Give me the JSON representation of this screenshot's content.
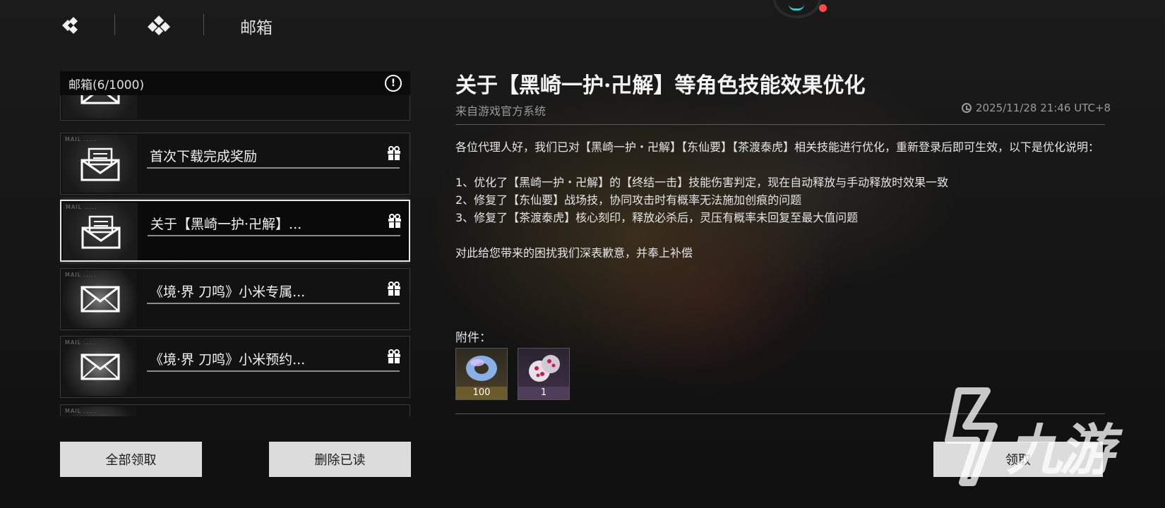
{
  "top_bar": {
    "page_title": "邮箱"
  },
  "mail_list": {
    "header": "邮箱(6/1000)",
    "items": [
      {
        "title": ""
      },
      {
        "title": "首次下载完成奖励"
      },
      {
        "title": "关于【黑崎一护·卍解】..."
      },
      {
        "title": "《境·界 刀鸣》小米专属..."
      },
      {
        "title": "《境·界 刀鸣》小米预约..."
      }
    ],
    "thumb_label": "MAIL ....."
  },
  "buttons": {
    "claim_all": "全部领取",
    "delete_read": "删除已读",
    "claim": "领取"
  },
  "detail": {
    "title": "关于【黑崎一护·卍解】等角色技能效果优化",
    "sender": "来自游戏官方系统",
    "time": "2025/11/28 21:46 UTC+8",
    "paragraphs": [
      "各位代理人好，我们已对【黑崎一护・卍解】【东仙要】【茶渡泰虎】相关技能进行优化，重新登录后即可生效，以下是优化说明：",
      "1、优化了【黑崎一护・卍解】的【终结一击】技能伤害判定，现在自动释放与手动释放时效果一致",
      "2、修复了【东仙要】战场技，协同攻击时有概率无法施加创痕的问题",
      "3、修复了【茶渡泰虎】核心刻印，释放必杀后，灵压有概率未回复至最大值问题",
      "对此给您带来的困扰我们深表歉意，并奉上补偿"
    ],
    "attachments_label": "附件：",
    "attachments": [
      {
        "count": "100",
        "icon": "ring-crystal-icon"
      },
      {
        "count": "1",
        "icon": "dice-item-icon"
      }
    ]
  },
  "watermark": {
    "text": "九游"
  },
  "colors": {
    "accent_teal": "#3bc4cc",
    "notify_red": "#ff4a4a",
    "button_bg": "#dcdcdc"
  }
}
